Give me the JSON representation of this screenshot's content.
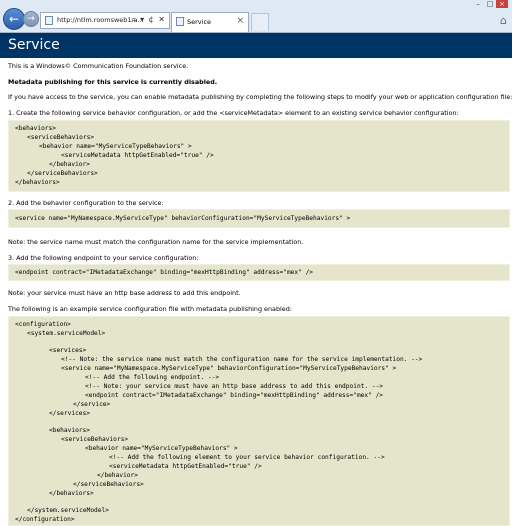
{
  "browser": {
    "address_url": "http://ntlm.roomsweb1.a...",
    "address_icons": "⌕ ▾ ¢ ✕",
    "tab_title": "Service",
    "tab_close": "×",
    "back_label": "←",
    "forward_label": "→",
    "window_controls": [
      "–",
      "□",
      "×"
    ]
  },
  "page": {
    "heading": "Service",
    "intro": "This is a Windows© Communication Foundation service.",
    "disabled": "Metadata publishing for this service is currently disabled.",
    "access": "If you have access to the service, you can enable metadata publishing by completing the following steps to modify your web or application configuration file:",
    "step1": "1. Create the following service behavior configuration, or add the <serviceMetadata> element to an existing service behavior configuration:",
    "step2": "2. Add the behavior configuration to the service:",
    "note1": "Note: the service name must match the configuration name for the service implementation.",
    "step3": "3. Add the following endpoint to your service configuration:",
    "note2": "Note: your service must have an http base address to add this endpoint.",
    "example": "The following is an example service configuration file with metadata publishing enabled:"
  },
  "code1": [
    "<behaviors>",
    "<serviceBehaviors>",
    "<behavior name=\"MyServiceTypeBehaviors\" >",
    "<serviceMetadata httpGetEnabled=\"true\" />",
    "</behavior>",
    "</serviceBehaviors>",
    "</behaviors>"
  ],
  "code2": "<service name=\"MyNamespace.MyServiceType\" behaviorConfiguration=\"MyServiceTypeBehaviors\" >",
  "code3": "<endpoint contract=\"IMetadataExchange\" binding=\"mexHttpBinding\" address=\"mex\" />",
  "code4": [
    "<configuration>",
    "<system.serviceModel>",
    "<services>",
    "<!-- Note: the service name must match the configuration name for the service implementation. -->",
    "<service name=\"MyNamespace.MyServiceType\" behaviorConfiguration=\"MyServiceTypeBehaviors\" >",
    "<!-- Add the following endpoint.  -->",
    "<!-- Note: your service must have an http base address to add this endpoint. -->",
    "<endpoint contract=\"IMetadataExchange\" binding=\"mexHttpBinding\" address=\"mex\" />",
    "</service>",
    "</services>",
    "<behaviors>",
    "<serviceBehaviors>",
    "<behavior name=\"MyServiceTypeBehaviors\" >",
    "<!-- Add the following element to your service behavior configuration. -->",
    "<serviceMetadata httpGetEnabled=\"true\" />",
    "</behavior>",
    "</serviceBehaviors>",
    "</behaviors>",
    "</system.serviceModel>",
    "</configuration>"
  ]
}
